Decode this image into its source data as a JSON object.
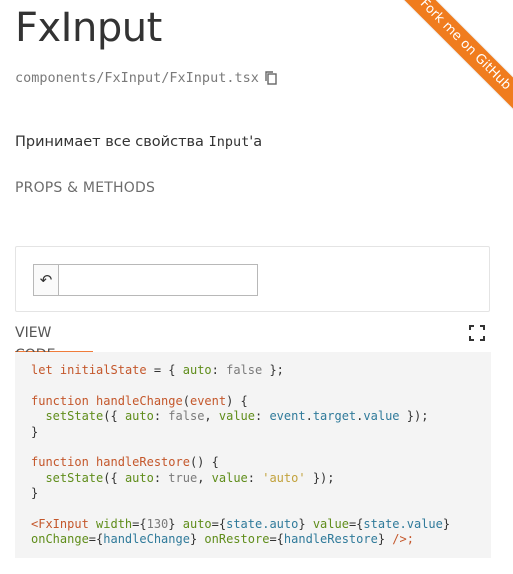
{
  "header": {
    "title": "FxInput",
    "path": "components/FxInput/FxInput.tsx",
    "copy_icon": "copy-icon"
  },
  "ribbon": {
    "label": "Fork me on GitHub"
  },
  "description": {
    "text_prefix": "Принимает все свойства ",
    "code": "Input",
    "text_suffix": "'а"
  },
  "props_link": {
    "label": "PROPS & METHODS"
  },
  "demo": {
    "restore_icon": "undo-icon",
    "restore_glyph": "↶",
    "input_value": ""
  },
  "code_tab": {
    "label": "VIEW CODE",
    "expand_icon": "fullscreen-icon"
  },
  "colors": {
    "accent": "#f07c3a",
    "ribbon": "#f07c1e"
  },
  "code": {
    "l1": [
      "let",
      " ",
      "initialState",
      " = { ",
      "auto",
      ": ",
      "false",
      " };"
    ],
    "l3": [
      "function",
      " ",
      "handleChange",
      "(",
      "event",
      ") {"
    ],
    "l4": [
      "  ",
      "setState",
      "({ ",
      "auto",
      ": ",
      "false",
      ", ",
      "value",
      ": ",
      "event",
      ".",
      "target",
      ".",
      "value",
      " });"
    ],
    "l5": "}",
    "l7": [
      "function",
      " ",
      "handleRestore",
      "() {"
    ],
    "l8": [
      "  ",
      "setState",
      "({ ",
      "auto",
      ": ",
      "true",
      ", ",
      "value",
      ": ",
      "'auto'",
      " });"
    ],
    "l9": "}",
    "l11": [
      "<FxInput",
      " ",
      "width",
      "={",
      "130",
      "} ",
      "auto",
      "={",
      "state.auto",
      "} ",
      "value",
      "={",
      "state.value",
      "}"
    ],
    "l12": [
      "onChange",
      "={",
      "handleChange",
      "} ",
      "onRestore",
      "={",
      "handleRestore",
      "} ",
      "/>;"
    ]
  }
}
